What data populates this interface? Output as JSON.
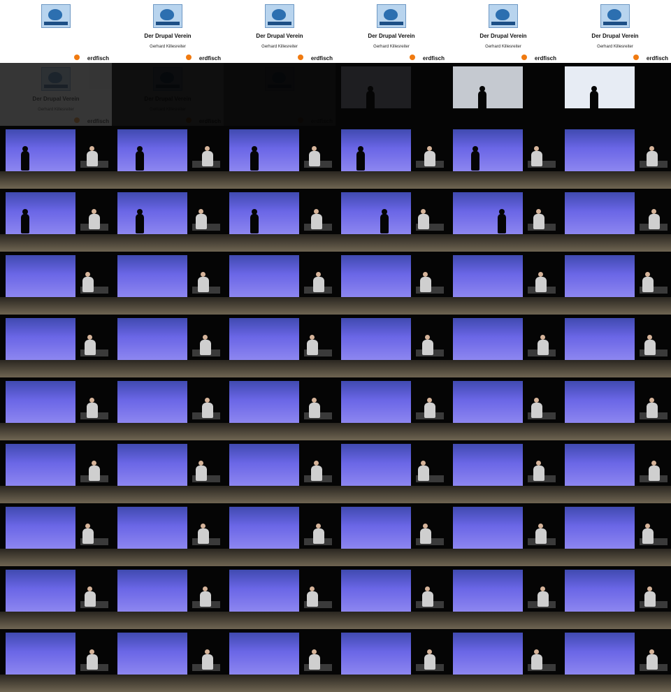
{
  "title_slide": {
    "title": "Der Drupal Verein",
    "author": "Gerhard Killesreiter",
    "brand": "erdfisch"
  }
}
